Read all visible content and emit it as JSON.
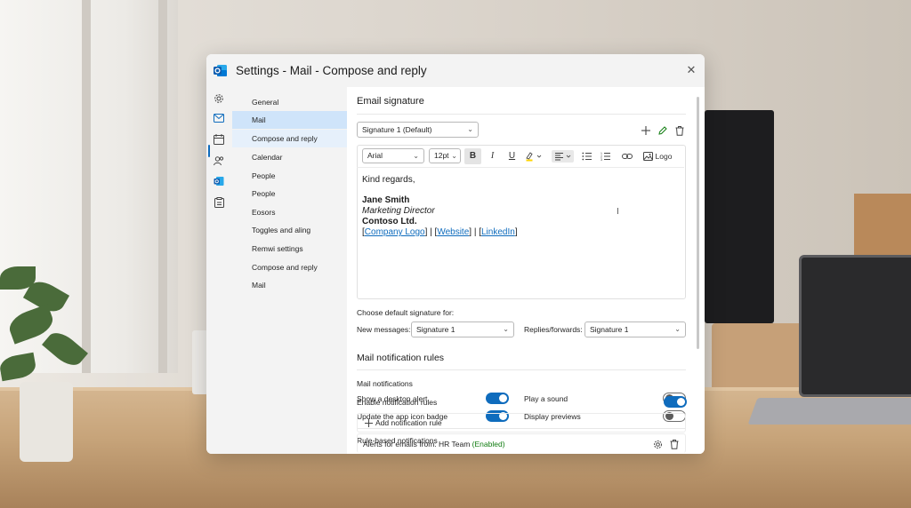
{
  "dialog": {
    "title": "Settings - Mail - Compose and reply",
    "close_glyph": "✕"
  },
  "rail": {
    "icons": [
      "gear-icon",
      "mail-icon",
      "calendar-icon",
      "people-icon",
      "outlook-icon",
      "clipboard-icon"
    ]
  },
  "nav": {
    "items": [
      {
        "label": "General",
        "state": "normal"
      },
      {
        "label": "Mail",
        "state": "selected"
      },
      {
        "label": "Compose and reply",
        "state": "hover"
      },
      {
        "label": "Calendar",
        "state": "normal"
      },
      {
        "label": "People",
        "state": "normal"
      },
      {
        "label": "People",
        "state": "normal"
      },
      {
        "label": "Eosors",
        "state": "normal"
      },
      {
        "label": "Toggles and aling",
        "state": "normal"
      },
      {
        "label": "Remwi settings",
        "state": "normal"
      },
      {
        "label": "Compose and reply",
        "state": "normal"
      },
      {
        "label": "Mail",
        "state": "normal"
      }
    ]
  },
  "signature": {
    "heading": "Email signature",
    "selected_signature": "Signature 1 (Default)",
    "toolbar": {
      "font": "Arial",
      "size": "12pt",
      "bold": "B",
      "italic": "I",
      "underline": "U",
      "logo_label": "Logo"
    },
    "body": {
      "closing": "Kind regards,",
      "name": "Jane Smith",
      "job_title": "Marketing Director",
      "company": "Contoso Ltd.",
      "link_open1": "[",
      "link1": "Company Logo",
      "sep1": "] | [",
      "link2": "Website",
      "sep2": "] | [",
      "link3": "LinkedIn",
      "link_close": "]"
    },
    "default_label": "Choose default signature for:",
    "new_messages_label": "New messages:",
    "new_messages_value": "Signature 1",
    "replies_label": "Replies/forwards:",
    "replies_value": "Signature 1"
  },
  "notifications": {
    "heading": "Mail notification rules",
    "mail_section": "Mail notifications",
    "desktop_alert": {
      "label": "Show a desktop alert",
      "on": true
    },
    "play_sound": {
      "label": "Play a sound",
      "on": false
    },
    "app_badge": {
      "label": "Update the app icon badge",
      "on": true
    },
    "display_previews": {
      "label": "Display previews",
      "on": false
    },
    "rule_section": "Rule-based notifications",
    "enable_rules": {
      "label": "Enable notification rules",
      "on": true
    },
    "add_rule_label": "Add notification rule",
    "rule_item_text": "Alerts for emails from: HR Team",
    "rule_item_status": "(Enabled)"
  },
  "colors": {
    "accent": "#0f6cbd",
    "selected_nav": "#cfe4fa",
    "enabled_text": "#107c10"
  }
}
